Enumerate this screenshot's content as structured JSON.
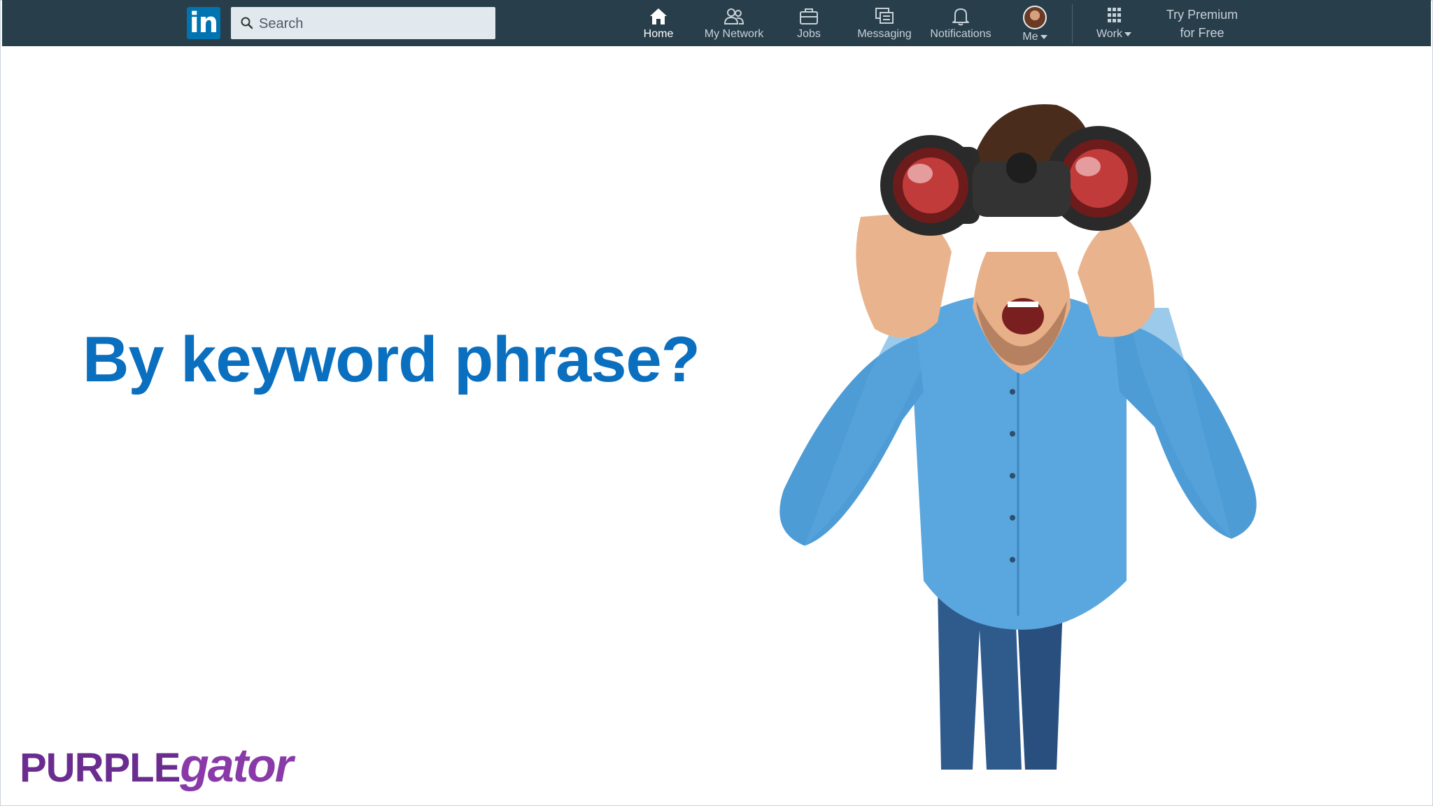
{
  "topbar": {
    "logo_text": "in",
    "search": {
      "placeholder": "Search",
      "value": ""
    },
    "nav": [
      {
        "label": "Home",
        "icon": "home-icon",
        "active": true
      },
      {
        "label": "My Network",
        "icon": "network-icon"
      },
      {
        "label": "Jobs",
        "icon": "briefcase-icon"
      },
      {
        "label": "Messaging",
        "icon": "messaging-icon"
      },
      {
        "label": "Notifications",
        "icon": "bell-icon"
      },
      {
        "label": "Me",
        "icon": "avatar"
      },
      {
        "label": "Work",
        "icon": "grid-icon"
      }
    ],
    "premium": {
      "line1": "Try Premium",
      "line2": "for Free"
    }
  },
  "slide": {
    "headline": "By keyword phrase?",
    "brand_part1": "PURPLE",
    "brand_part2": "gator"
  },
  "colors": {
    "topbar": "#283e4a",
    "linkedin_blue": "#0073b1",
    "headline": "#0a6fbf",
    "brand_purple": "#6b2c8f"
  }
}
